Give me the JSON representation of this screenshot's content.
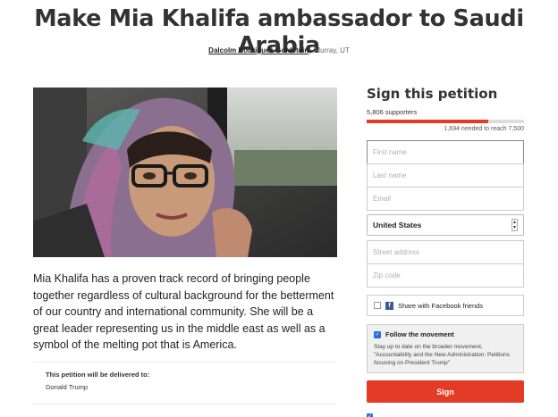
{
  "petition": {
    "title": "Make Mia Khalifa ambassador to Saudi Arabia",
    "author": "Dalcolm Rodriguez-Goldstein",
    "location": "Murray, UT",
    "description": "Mia Khalifa has a proven track record of bringing people together regardless of cultural background for the betterment of our country and international community.  She will be a great leader representing us in the middle east as well as a symbol of the melting pot that is America.",
    "delivered_label": "This petition will be delivered to:",
    "delivered_to": "Donald Trump"
  },
  "sign_panel": {
    "heading": "Sign this petition",
    "supporters": "5,806 supporters",
    "needed": "1,694 needed to reach 7,500",
    "progress_fraction": 0.774,
    "fields": {
      "first_name": "First name",
      "last_name": "Last name",
      "email": "Email",
      "street": "Street address",
      "zip": "Zip code"
    },
    "country": "United States",
    "facebook_label": "Share with Facebook friends",
    "follow_label": "Follow the movement",
    "follow_text": "Stay up to date on the broader movement, \"Accountability and the New Administration: Petitions focusing on President Trump\"",
    "sign_button": "Sign"
  },
  "colors": {
    "accent": "#e33b25",
    "facebook": "#3b5998",
    "checkbox": "#2f6fd6"
  },
  "icons": [
    "facebook-icon",
    "checkbox-icon",
    "dropdown-icon"
  ]
}
